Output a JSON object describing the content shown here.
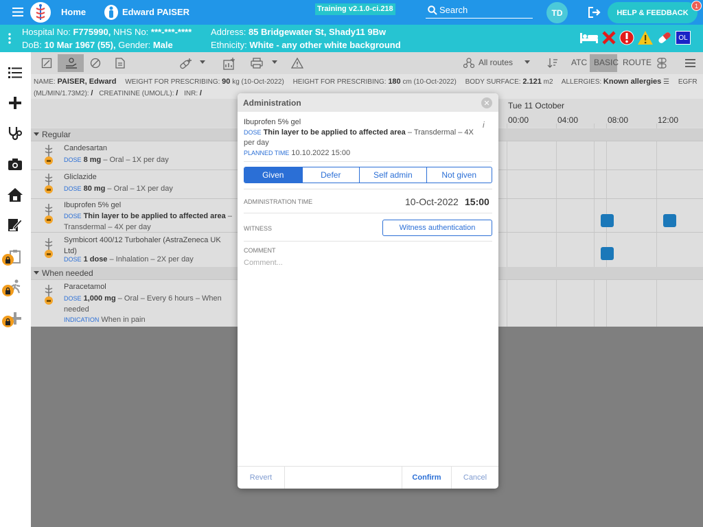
{
  "topbar": {
    "home": "Home",
    "patient_name": "Edward PAISER",
    "version": "Training v2.1.0-ci.218",
    "search_placeholder": "Search",
    "user_initials": "TD",
    "help": "HELP & FEEDBACK",
    "notification_count": "1"
  },
  "patient": {
    "hospital_label": "Hospital No:",
    "hospital_no": "F775990,",
    "nhs_label": "NHS No:",
    "nhs_no": "***-***-****",
    "dob_label": "DoB:",
    "dob": "10 Mar 1967 (55),",
    "gender_label": "Gender:",
    "gender": "Male",
    "address_label": "Address:",
    "address": "85 Bridgewater St, Shady11 9Bw",
    "ethnicity_label": "Ethnicity:",
    "ethnicity": "White - any other white background",
    "badge": "OL"
  },
  "toolbar": {
    "routes": "All routes",
    "atc": "ATC",
    "basic": "BASIC",
    "route": "ROUTE"
  },
  "info": {
    "name_label": "NAME:",
    "name": "PAISER, Edward",
    "weight_label": "WEIGHT FOR PRESCRIBING:",
    "weight": "90",
    "weight_unit": "kg (10-Oct-2022)",
    "height_label": "HEIGHT FOR PRESCRIBING:",
    "height": "180",
    "height_unit": "cm (10-Oct-2022)",
    "surface_label": "BODY SURFACE:",
    "surface": "2.121",
    "surface_unit": "m2",
    "allergies_label": "ALLERGIES:",
    "allergies": "Known allergies",
    "egfr_label": "EGFR",
    "egfr_unit": "(ML/MIN/1.73M2):",
    "egfr_value": "/",
    "creatinine_label": "CREATININE (UMOL/L):",
    "creatinine_value": "/",
    "inr_label": "INR:",
    "inr_value": "/"
  },
  "chart": {
    "day": "Tue 11 October",
    "times": [
      "00:00",
      "04:00",
      "08:00",
      "12:00"
    ],
    "section_regular": "Regular",
    "section_when_needed": "When needed",
    "dose_key": "DOSE",
    "indication_key": "INDICATION",
    "meds": [
      {
        "name": "Candesartan",
        "dose_bold": "8 mg",
        "dose_rest": " – Oral – 1X per day"
      },
      {
        "name": "Gliclazide",
        "dose_bold": "80 mg",
        "dose_rest": " – Oral – 1X per day"
      },
      {
        "name": "Ibuprofen 5% gel",
        "dose_bold": "Thin layer to be applied to affected area",
        "dose_rest": " – Transdermal – 4X per day"
      },
      {
        "name": "Symbicort 400/12 Turbohaler (AstraZeneca UK Ltd)",
        "dose_bold": "1 dose",
        "dose_rest": " – Inhalation – 2X per day"
      },
      {
        "name": "Paracetamol",
        "dose_bold": "1,000 mg",
        "dose_rest": " – Oral – Every 6 hours – When needed",
        "indication": "When in pain"
      }
    ]
  },
  "modal": {
    "title": "Administration",
    "drug": "Ibuprofen 5% gel",
    "dose_key": "DOSE",
    "dose_bold": "Thin layer to be applied to affected area",
    "dose_rest": " – Transdermal – 4X per day",
    "planned_key": "PLANNED TIME",
    "planned_value": "10.10.2022 15:00",
    "options": [
      "Given",
      "Defer",
      "Self admin",
      "Not given"
    ],
    "admin_time_label": "ADMINISTRATION TIME",
    "admin_date": "10-Oct-2022",
    "admin_time": "15:00",
    "witness_label": "WITNESS",
    "witness_button": "Witness authentication",
    "comment_label": "COMMENT",
    "comment_placeholder": "Comment...",
    "revert": "Revert",
    "confirm": "Confirm",
    "cancel": "Cancel"
  },
  "colors": {
    "topbar": "#2196e8",
    "patient_bar": "#26c4d2",
    "accent": "#2b6fd6",
    "dose_block": "#1b78b9",
    "lock": "#f19b1b"
  }
}
